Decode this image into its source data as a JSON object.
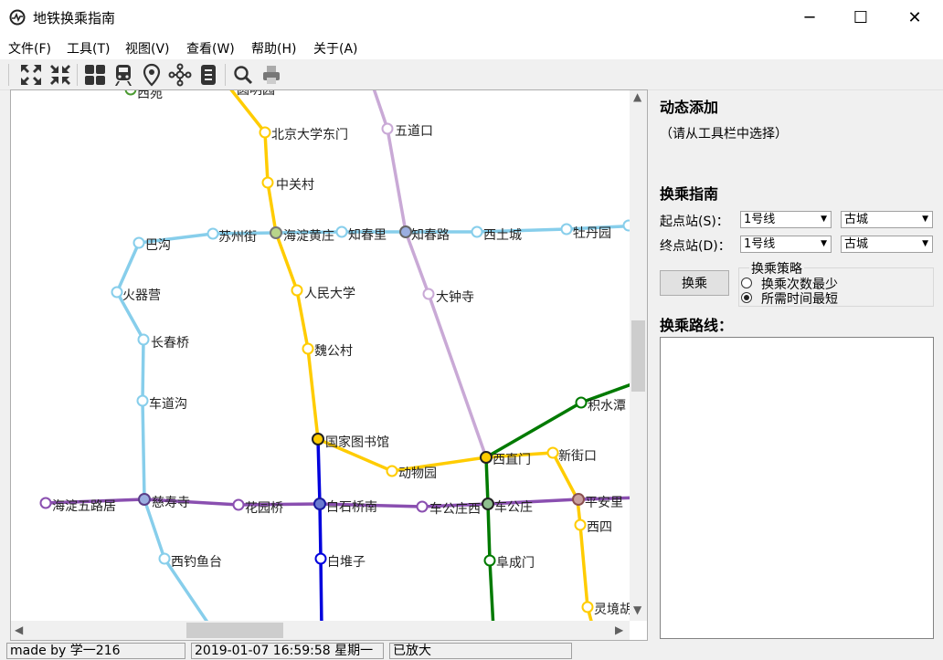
{
  "window": {
    "title": "地铁换乘指南",
    "controls": {
      "minimize": "─",
      "maximize": "☐",
      "close": "✕"
    }
  },
  "menu": [
    "文件(F)",
    "工具(T)",
    "视图(V)",
    "查看(W)",
    "帮助(H)",
    "关于(A)"
  ],
  "toolbar": [
    "expand-icon",
    "collapse-icon",
    "grid-icon",
    "train-icon",
    "location-pin-icon",
    "network-icon",
    "list-icon",
    "search-icon",
    "print-icon"
  ],
  "map": {
    "colors": {
      "line1": "#0000dd",
      "line2": "#007a00",
      "line3": "#87ceeb",
      "line4": "#ffcc00",
      "line5": "#8a4fb0",
      "line6": "#c9a9d6"
    },
    "stations": {
      "xiyuan": "西苑",
      "yuanmingyuan": "圆明园",
      "beida_dongmen": "北京大学东门",
      "zhongguancun": "中关村",
      "haidian_huangzhuang": "海淀黄庄",
      "renmin_daxue": "人民大学",
      "weigongcun": "魏公村",
      "guojia_tushuguan": "国家图书馆",
      "dongwuyuan": "动物园",
      "xizhimen": "西直门",
      "xinjiekou": "新街口",
      "pinganli": "平安里",
      "xisi": "西四",
      "lingjinghutong": "灵境胡",
      "wudaokou": "五道口",
      "zhichunlu": "知春路",
      "dazhongsi": "大钟寺",
      "zhichunli": "知春里",
      "suzhoujie": "苏州街",
      "bagou": "巴沟",
      "xitucheng": "西土城",
      "mudanyuan": "牡丹园",
      "huoqiying": "火器营",
      "changchunqiao": "长春桥",
      "chedaogou": "车道沟",
      "cishousi": "慈寿寺",
      "xidiaoyutai": "西钓鱼台",
      "haidian_wuluju": "海淀五路居",
      "huayuanqiao": "花园桥",
      "baishiqiao_nan": "白石桥南",
      "chegongzhuang_xi": "车公庄西",
      "chegongzhuang": "车公庄",
      "baiduizi": "白堆子",
      "fuchengmen": "阜成门",
      "jishuitan": "积水潭"
    }
  },
  "panel": {
    "dynamic_add_title": "动态添加",
    "dynamic_add_hint": "（请从工具栏中选择）",
    "guide_title": "换乘指南",
    "start_label": "起点站(S)：",
    "end_label": "终点站(D)：",
    "start_line": "1号线",
    "start_station": "古城",
    "end_line": "1号线",
    "end_station": "古城",
    "transfer_button": "换乘",
    "strategy_title": "换乘策略",
    "strategy_options": [
      {
        "label": "换乘次数最少",
        "selected": false
      },
      {
        "label": "所需时间最短",
        "selected": true
      }
    ],
    "route_title": "换乘路线："
  },
  "status": {
    "author": "made by 学一216",
    "datetime": "2019-01-07 16:59:58 星期一",
    "zoom": "已放大"
  }
}
